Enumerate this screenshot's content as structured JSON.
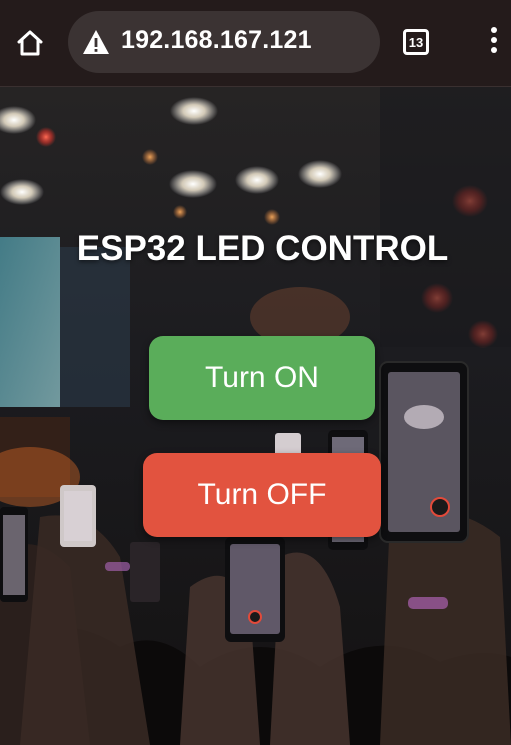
{
  "browser": {
    "url": "192.168.167.121",
    "tab_count": "13",
    "icons": {
      "home": "home-icon",
      "security": "warning-triangle-icon",
      "tabs": "tab-switcher-icon",
      "menu": "more-vert-icon"
    }
  },
  "page": {
    "title": "ESP32 LED CONTROL",
    "buttons": {
      "on_label": "Turn ON",
      "off_label": "Turn OFF"
    },
    "colors": {
      "on_button": "#5aad5a",
      "off_button": "#e2533f",
      "browser_bar": "#241b1b"
    }
  }
}
